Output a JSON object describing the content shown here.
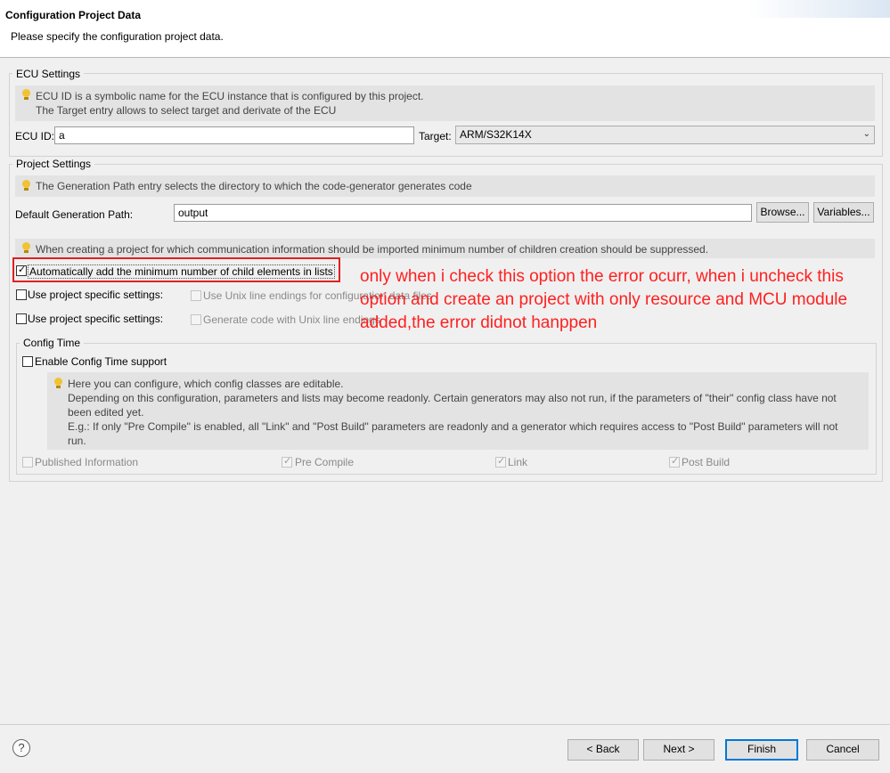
{
  "header": {
    "title": "Configuration Project Data",
    "description": "Please specify the configuration project data."
  },
  "ecu": {
    "group_title": "ECU Settings",
    "info_line1": "ECU ID is a symbolic name for the ECU instance that is configured by this project.",
    "info_line2": "The Target entry allows to select target and derivate of the ECU",
    "ecu_id_label": "ECU ID:",
    "ecu_id_value": "a",
    "target_label": "Target:",
    "target_value": "ARM/S32K14X"
  },
  "project": {
    "group_title": "Project Settings",
    "info_gen_path": "The Generation Path entry selects the directory to which the code-generator generates code",
    "gen_path_label": "Default Generation Path:",
    "gen_path_value": "output",
    "browse_label": "Browse...",
    "variables_label": "Variables...",
    "info_children": "When creating a project for which communication information should be imported minimum number of children creation should be suppressed.",
    "auto_add_label": "Automatically add the minimum number of child elements in lists",
    "auto_add_checked": true,
    "use_specific_1_label": "Use project specific settings:",
    "unix_line_endings_label": "Use Unix line endings for configuration data files",
    "use_specific_2_label": "Use project specific settings:",
    "generate_unix_label": "Generate code with Unix line endings"
  },
  "config_time": {
    "group_title": "Config Time",
    "enable_label": "Enable Config Time support",
    "info_lines": [
      "Here you can configure, which config classes are editable.",
      "Depending on this configuration, parameters and lists may become readonly. Certain generators may also not run, if the parameters of \"their\" config class have not",
      "been edited yet.",
      "E.g.: If only \"Pre Compile\" is enabled, all \"Link\" and \"Post Build\" parameters are readonly and a generator which requires access to \"Post Build\" parameters will not",
      "run."
    ],
    "classes": [
      {
        "label": "Published Information",
        "checked": false
      },
      {
        "label": "Pre Compile",
        "checked": true
      },
      {
        "label": "Link",
        "checked": true
      },
      {
        "label": "Post Build",
        "checked": true
      }
    ]
  },
  "annotation": {
    "text": "only when i check this option the error ocurr, when i uncheck this option and create an project with only resource and MCU module added,the error didnot hanppen",
    "color": "#ff2020"
  },
  "footer": {
    "help_symbol": "?",
    "back_label": "< Back",
    "next_label": "Next >",
    "finish_label": "Finish",
    "cancel_label": "Cancel"
  }
}
